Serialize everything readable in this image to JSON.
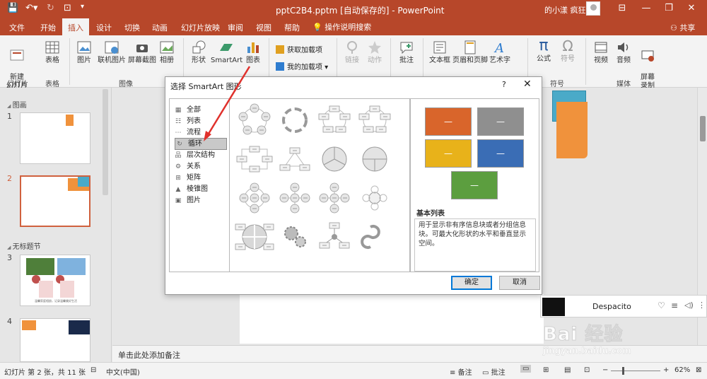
{
  "titlebar": {
    "title": "pptC2B4.pptm [自动保存的] - PowerPoint",
    "user": "的小漾 疯狂"
  },
  "tabs": [
    "文件",
    "开始",
    "插入",
    "设计",
    "切换",
    "动画",
    "幻灯片放映",
    "审阅",
    "视图",
    "帮助"
  ],
  "active_tab": "插入",
  "help_search": "操作说明搜索",
  "share": "共享",
  "ribbon": {
    "new_slide": "新建\n幻灯片 ▾",
    "table": "表格",
    "picture": "图片",
    "online_picture": "联机图片",
    "screenshot": "屏幕截图",
    "album": "相册",
    "shapes": "形状",
    "smartart": "SmartArt",
    "chart": "图表",
    "get_addins": "获取加载项",
    "my_addins": "我的加载项",
    "link": "链接",
    "action": "动作",
    "comment": "批注",
    "textbox": "文本框",
    "header_footer": "页眉和页脚",
    "wordart": "艺术字",
    "equation": "公式",
    "symbol": "符号",
    "video": "视频",
    "audio": "音频",
    "screen_record": "屏幕\n录制",
    "groups": {
      "slides": "幻灯片",
      "table": "表格",
      "image": "图像",
      "symbols": "符号",
      "media": "媒体"
    }
  },
  "left_panel": {
    "section1": "图画",
    "section2": "无标题节",
    "slide_numbers": [
      "1",
      "2",
      "3",
      "4"
    ],
    "slide3_caption": "温馨家庭相册，记录温馨美好生活"
  },
  "dialog": {
    "title": "选择 SmartArt 图形",
    "help": "?",
    "close": "✕",
    "categories": [
      {
        "icon": "▦",
        "label": "全部"
      },
      {
        "icon": "☷",
        "label": "列表"
      },
      {
        "icon": "⋯",
        "label": "流程"
      },
      {
        "icon": "↻",
        "label": "循环"
      },
      {
        "icon": "品",
        "label": "层次结构"
      },
      {
        "icon": "⚙",
        "label": "关系"
      },
      {
        "icon": "⊞",
        "label": "矩阵"
      },
      {
        "icon": "▲",
        "label": "棱锥图"
      },
      {
        "icon": "▣",
        "label": "图片"
      }
    ],
    "selected_category": "循环",
    "preview_name": "基本列表",
    "preview_desc": "用于显示非有序信息块或者分组信息块。可最大化形状的水平和垂直显示空间。",
    "preview_box_label": "—",
    "preview_colors": [
      "#d9652b",
      "#8f8f8f",
      "#e8b21a",
      "#3a6db5",
      "#5c9e3f"
    ],
    "ok": "确定",
    "cancel": "取消"
  },
  "notes_placeholder": "单击此处添加备注",
  "status": {
    "slide_info": "幻灯片 第 2 张，共 11 张",
    "language": "中文(中国)",
    "notes": "备注",
    "comments": "批注",
    "zoom": "62%"
  },
  "music": {
    "song": "Despacito"
  },
  "watermark": {
    "brand": "Bai 经验",
    "url": "jingyan.baidu.com"
  },
  "colors": {
    "accent": "#b7472a",
    "selection_border": "#d0613e",
    "dialog_primary": "#0078d7"
  }
}
